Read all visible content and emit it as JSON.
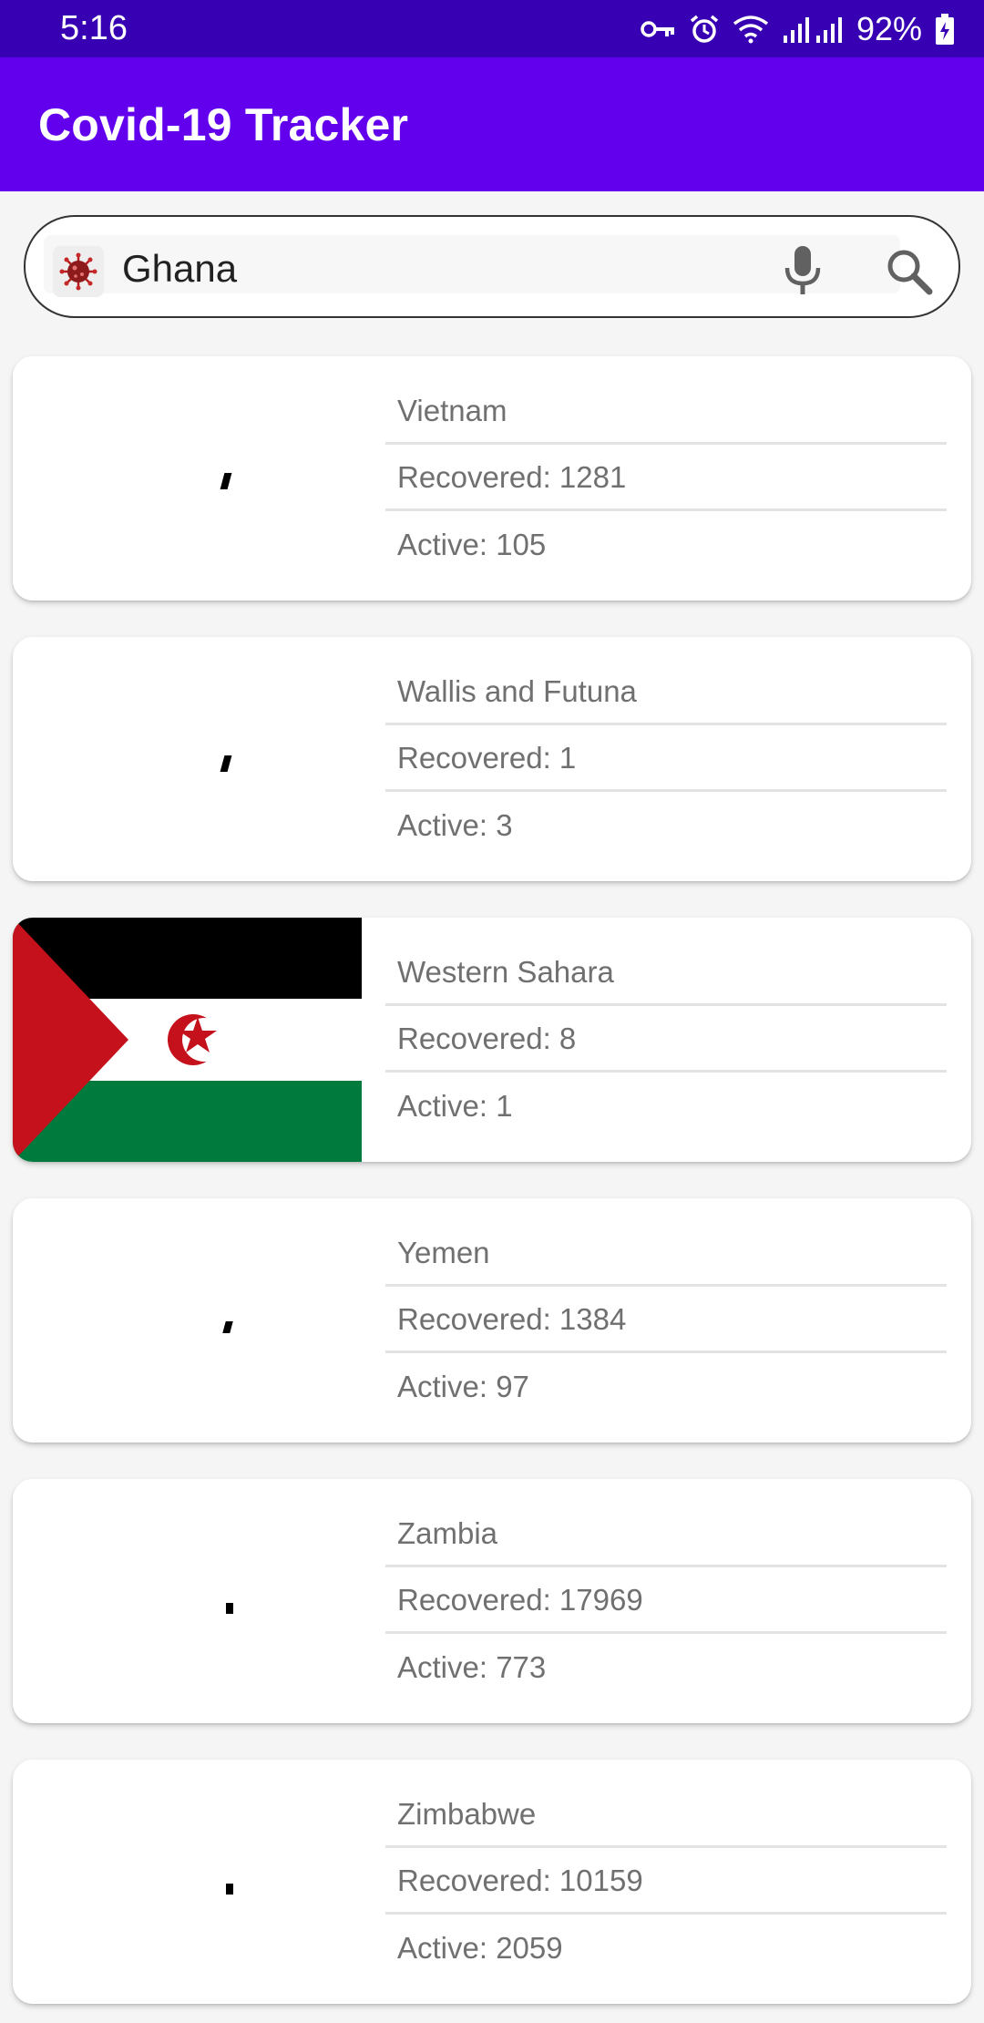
{
  "status_bar": {
    "time": "5:16",
    "battery": "92%"
  },
  "app_bar": {
    "title": "Covid-19 Tracker"
  },
  "search": {
    "value": "Ghana"
  },
  "countries": [
    {
      "name": "Vietnam",
      "recovered": "Recovered: 1281",
      "active": "Active: 105",
      "flag": "loading"
    },
    {
      "name": "Wallis and Futuna",
      "recovered": "Recovered: 1",
      "active": "Active: 3",
      "flag": "loading"
    },
    {
      "name": "Western Sahara",
      "recovered": "Recovered: 8",
      "active": "Active: 1",
      "flag": "western-sahara"
    },
    {
      "name": "Yemen",
      "recovered": "Recovered: 1384",
      "active": "Active: 97",
      "flag": "loading"
    },
    {
      "name": "Zambia",
      "recovered": "Recovered: 17969",
      "active": "Active: 773",
      "flag": "loading"
    },
    {
      "name": "Zimbabwe",
      "recovered": "Recovered: 10159",
      "active": "Active: 2059",
      "flag": "loading"
    }
  ],
  "colors": {
    "status_bar": "#3700b3",
    "app_bar": "#6200ee",
    "flag_black": "#000000",
    "flag_green": "#007a3d",
    "flag_red": "#c4111b"
  },
  "icons": [
    "key-icon",
    "alarm-icon",
    "wifi-icon",
    "signal-icon",
    "battery-icon",
    "virus-icon",
    "mic-icon",
    "search-icon"
  ]
}
